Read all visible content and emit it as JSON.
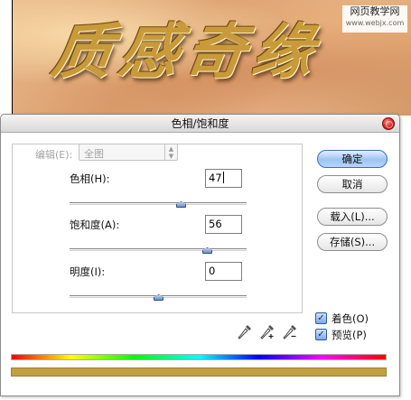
{
  "artwork": {
    "title_text": "质感奇缘",
    "watermark_line1": "网页教学网",
    "watermark_line2": "www.webjx.com"
  },
  "dialog": {
    "title": "色相/饱和度",
    "edit": {
      "label": "编辑(E):",
      "selected": "全图"
    },
    "hue": {
      "label": "色相(H):",
      "value": "47",
      "level": 47,
      "range": [
        -180,
        180
      ]
    },
    "saturation": {
      "label": "饱和度(A):",
      "value": "56",
      "level": 56,
      "range": [
        -100,
        100
      ]
    },
    "lightness": {
      "label": "明度(I):",
      "value": "0",
      "level": 0,
      "range": [
        -100,
        100
      ]
    },
    "buttons": {
      "ok": "确定",
      "cancel": "取消",
      "load": "载入(L)...",
      "save": "存储(S)..."
    },
    "options": {
      "colorize_label": "着色(O)",
      "colorize_checked": true,
      "preview_label": "预览(P)",
      "preview_checked": true
    },
    "icons": [
      "eyedropper-icon",
      "eyedropper-plus-icon",
      "eyedropper-minus-icon"
    ],
    "colors": {
      "accent": "#9ec3f3",
      "close": "#e0322a",
      "adjusted_bar": "#c0a040"
    }
  }
}
